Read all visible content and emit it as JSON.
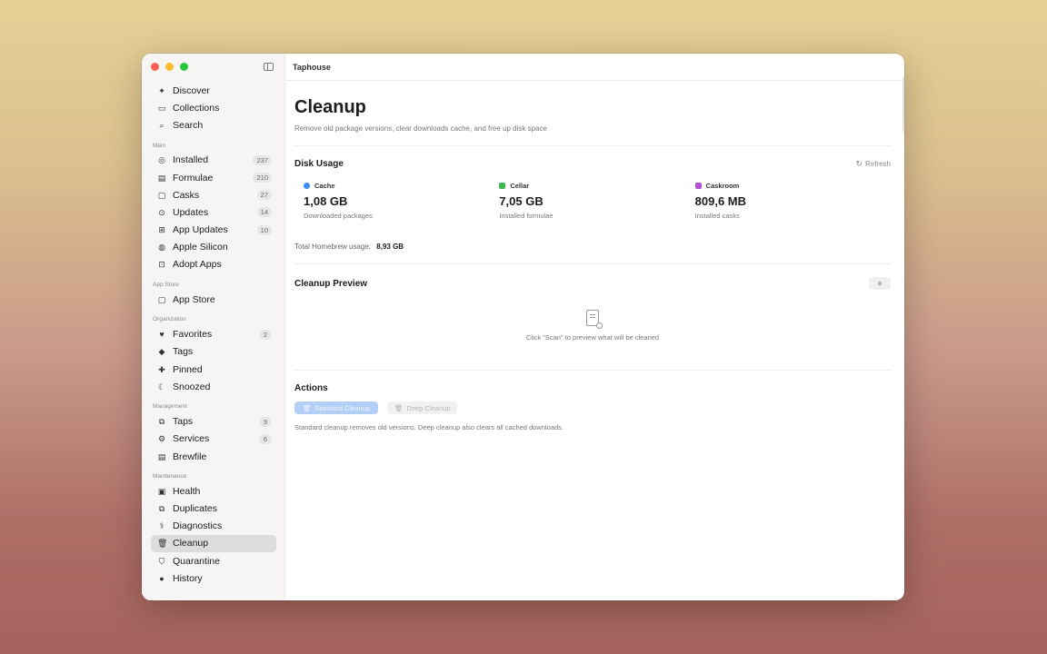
{
  "window": {
    "title": "Taphouse"
  },
  "sidebar": {
    "top_items": [
      {
        "label": "Discover",
        "icon": "sparkle-icon",
        "glyph": "✦"
      },
      {
        "label": "Collections",
        "icon": "collection-icon",
        "glyph": "▭"
      },
      {
        "label": "Search",
        "icon": "search-icon",
        "glyph": "⌕"
      }
    ],
    "sections": [
      {
        "title": "Main",
        "items": [
          {
            "label": "Installed",
            "icon": "check-circle-icon",
            "glyph": "◎",
            "badge": "237"
          },
          {
            "label": "Formulae",
            "icon": "terminal-icon",
            "glyph": "▤",
            "badge": "210"
          },
          {
            "label": "Casks",
            "icon": "cask-icon",
            "glyph": "▢",
            "badge": "27"
          },
          {
            "label": "Updates",
            "icon": "update-icon",
            "glyph": "⊙",
            "badge": "14"
          },
          {
            "label": "App Updates",
            "icon": "app-update-icon",
            "glyph": "⊞",
            "badge": "10"
          },
          {
            "label": "Apple Silicon",
            "icon": "chip-icon",
            "glyph": "◍",
            "badge": ""
          },
          {
            "label": "Adopt Apps",
            "icon": "adopt-icon",
            "glyph": "⊡",
            "badge": ""
          }
        ]
      },
      {
        "title": "App Store",
        "items": [
          {
            "label": "App Store",
            "icon": "bag-icon",
            "glyph": "▢",
            "badge": ""
          }
        ]
      },
      {
        "title": "Organization",
        "items": [
          {
            "label": "Favorites",
            "icon": "heart-icon",
            "glyph": "♥",
            "badge": "2"
          },
          {
            "label": "Tags",
            "icon": "tag-icon",
            "glyph": "◆",
            "badge": ""
          },
          {
            "label": "Pinned",
            "icon": "pin-icon",
            "glyph": "✚",
            "badge": ""
          },
          {
            "label": "Snoozed",
            "icon": "snooze-icon",
            "glyph": "☾",
            "badge": ""
          }
        ]
      },
      {
        "title": "Management",
        "items": [
          {
            "label": "Taps",
            "icon": "taps-icon",
            "glyph": "⧉",
            "badge": "9"
          },
          {
            "label": "Services",
            "icon": "gears-icon",
            "glyph": "⚙",
            "badge": "6"
          },
          {
            "label": "Brewfile",
            "icon": "document-icon",
            "glyph": "▤",
            "badge": ""
          }
        ]
      },
      {
        "title": "Maintenance",
        "items": [
          {
            "label": "Health",
            "icon": "health-icon",
            "glyph": "▣",
            "badge": ""
          },
          {
            "label": "Duplicates",
            "icon": "duplicate-icon",
            "glyph": "⧉",
            "badge": ""
          },
          {
            "label": "Diagnostics",
            "icon": "diagnostics-icon",
            "glyph": "⚕",
            "badge": ""
          },
          {
            "label": "Cleanup",
            "icon": "trash-icon",
            "glyph": "🗑",
            "badge": "",
            "active": true
          },
          {
            "label": "Quarantine",
            "icon": "shield-icon",
            "glyph": "⛉",
            "badge": ""
          },
          {
            "label": "History",
            "icon": "clock-icon",
            "glyph": "●",
            "badge": ""
          }
        ]
      }
    ]
  },
  "main": {
    "title": "Cleanup",
    "subtitle": "Remove old package versions, clear downloads cache, and free up disk space",
    "disk_usage": {
      "title": "Disk Usage",
      "refresh_label": "Refresh",
      "cards": [
        {
          "label": "Cache",
          "value": "1,08 GB",
          "desc": "Downloaded packages",
          "color": "#3b8ef0",
          "icon": "cache-icon"
        },
        {
          "label": "Cellar",
          "value": "7,05 GB",
          "desc": "Installed formulae",
          "color": "#3fb950",
          "icon": "cellar-icon"
        },
        {
          "label": "Caskroom",
          "value": "809,6 MB",
          "desc": "Installed casks",
          "color": "#b44fd6",
          "icon": "caskroom-icon"
        }
      ],
      "total_label": "Total Homebrew usage:",
      "total_value": "8,93 GB"
    },
    "preview": {
      "title": "Cleanup Preview",
      "empty_text": "Click \"Scan\" to preview what will be cleaned"
    },
    "actions": {
      "title": "Actions",
      "standard_label": "Standard Cleanup",
      "deep_label": "Deep Cleanup",
      "note": "Standard cleanup removes old versions. Deep cleanup also clears all cached downloads."
    }
  }
}
